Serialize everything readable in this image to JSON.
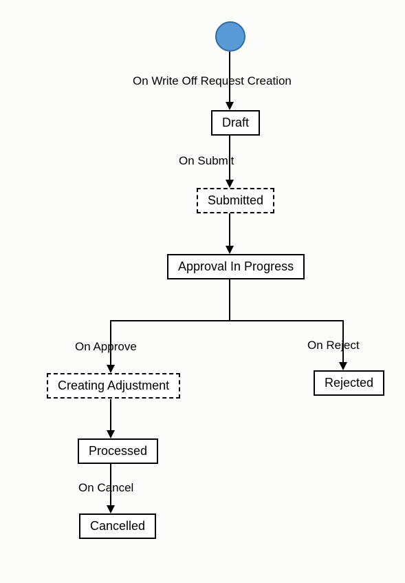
{
  "start": {
    "name": "start-node"
  },
  "labels": {
    "l1": "On Write Off Request Creation",
    "l2": "On Submit",
    "l3": "On Approve",
    "l4": "On Reject",
    "l5": "On Cancel"
  },
  "states": {
    "draft": "Draft",
    "submitted": "Submitted",
    "approval": "Approval In Progress",
    "creating": "Creating Adjustment",
    "rejected": "Rejected",
    "processed": "Processed",
    "cancelled": "Cancelled"
  }
}
